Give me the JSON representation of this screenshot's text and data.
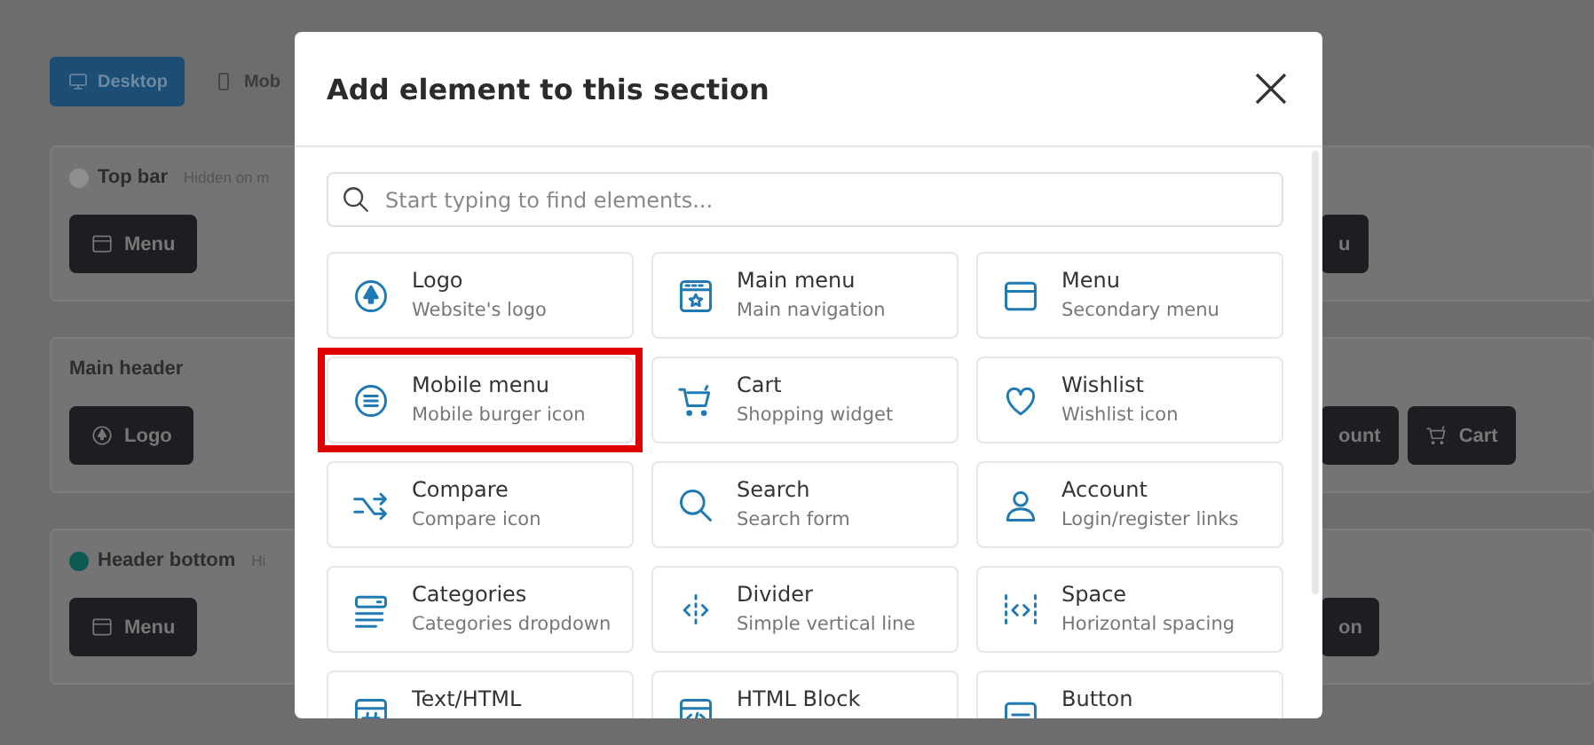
{
  "background": {
    "view_tabs": [
      {
        "label": "Desktop",
        "selected": true
      },
      {
        "label": "Mob",
        "selected": false
      }
    ],
    "sections": [
      {
        "title": "Top bar",
        "color": "#8e8e8e",
        "note": "Hidden on m",
        "left_chips": [
          {
            "label": "Menu"
          }
        ],
        "right_chips": [
          {
            "label": "u"
          }
        ]
      },
      {
        "title": "Main header",
        "left_chips": [
          {
            "label": "Logo"
          }
        ],
        "right_chips": [
          {
            "label": "ount"
          },
          {
            "label": "Cart"
          }
        ]
      },
      {
        "title": "Header bottom",
        "color": "#0e5a55",
        "note": "Hi",
        "left_chips": [
          {
            "label": "Menu"
          }
        ],
        "right_chips": [
          {
            "label": "on"
          }
        ]
      }
    ]
  },
  "modal": {
    "title": "Add element to this section",
    "search": {
      "placeholder": "Start typing to find elements..."
    },
    "items": [
      {
        "title": "Logo",
        "subtitle": "Website's logo",
        "highlighted": false
      },
      {
        "title": "Main menu",
        "subtitle": "Main navigation",
        "highlighted": false
      },
      {
        "title": "Menu",
        "subtitle": "Secondary menu",
        "highlighted": false
      },
      {
        "title": "Mobile menu",
        "subtitle": "Mobile burger icon",
        "highlighted": true
      },
      {
        "title": "Cart",
        "subtitle": "Shopping widget",
        "highlighted": false
      },
      {
        "title": "Wishlist",
        "subtitle": "Wishlist icon",
        "highlighted": false
      },
      {
        "title": "Compare",
        "subtitle": "Compare icon",
        "highlighted": false
      },
      {
        "title": "Search",
        "subtitle": "Search form",
        "highlighted": false
      },
      {
        "title": "Account",
        "subtitle": "Login/register links",
        "highlighted": false
      },
      {
        "title": "Categories",
        "subtitle": "Categories dropdown",
        "highlighted": false
      },
      {
        "title": "Divider",
        "subtitle": "Simple vertical line",
        "highlighted": false
      },
      {
        "title": "Space",
        "subtitle": "Horizontal spacing",
        "highlighted": false
      },
      {
        "title": "Text/HTML",
        "highlighted": false
      },
      {
        "title": "HTML Block",
        "highlighted": false
      },
      {
        "title": "Button",
        "highlighted": false
      }
    ]
  }
}
